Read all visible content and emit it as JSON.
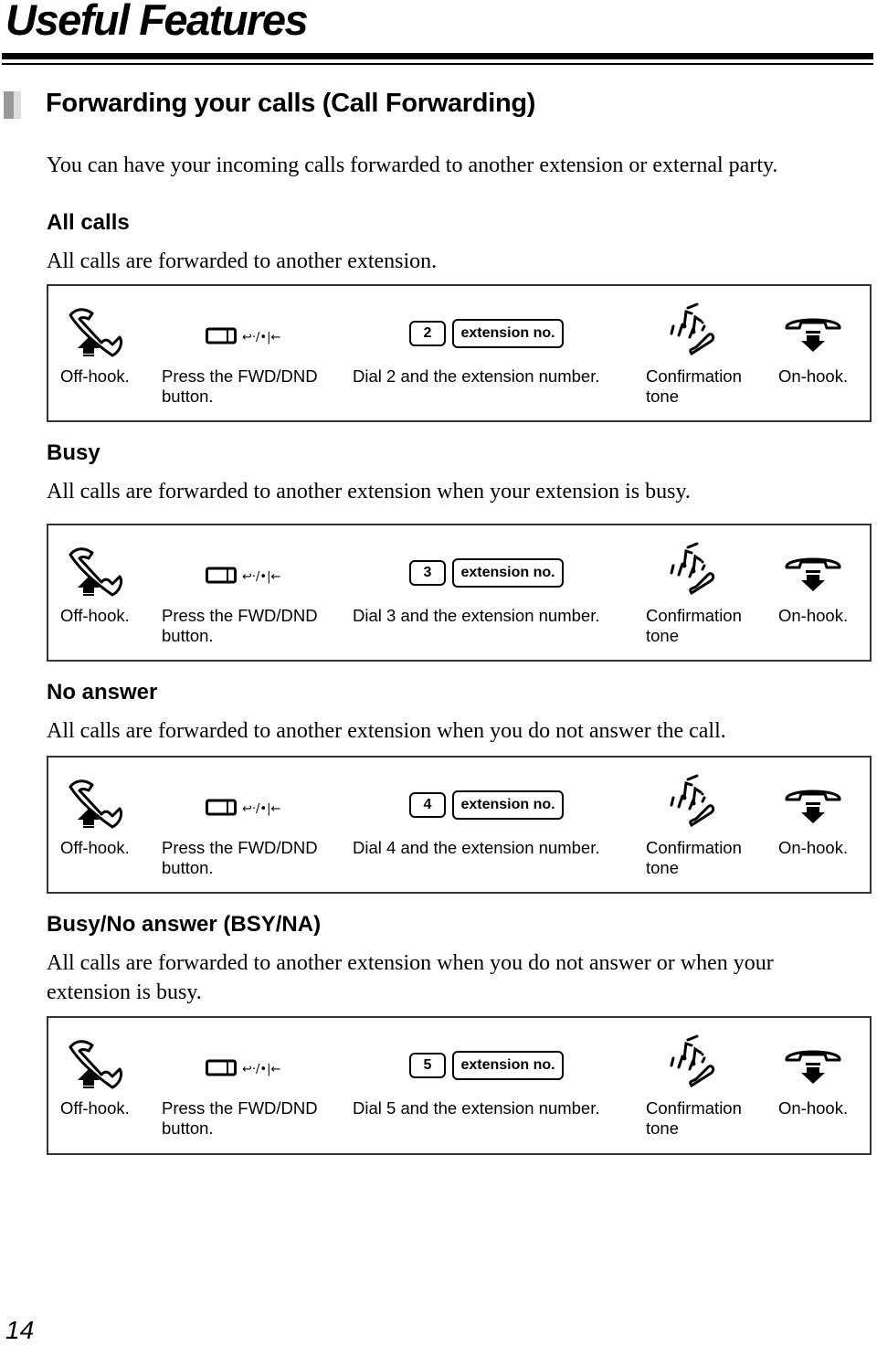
{
  "page": {
    "title": "Useful Features",
    "page_number": "14"
  },
  "section": {
    "title": "Forwarding your calls (Call Forwarding)",
    "intro": "You can have your incoming calls forwarded to another extension or external party."
  },
  "procedures": [
    {
      "heading": "All calls",
      "description": "All calls are forwarded to another extension.",
      "steps": {
        "off_hook": "Off-hook.",
        "press_fwd": "Press the FWD/DND button.",
        "dial_key": "2",
        "ext_key": "extension no.",
        "dial_text": "Dial 2 and the extension number.",
        "confirm": "Confirmation tone",
        "on_hook": "On-hook."
      }
    },
    {
      "heading": "Busy",
      "description": "All calls are forwarded to another extension when your extension is busy.",
      "steps": {
        "off_hook": "Off-hook.",
        "press_fwd": "Press the FWD/DND button.",
        "dial_key": "3",
        "ext_key": "extension no.",
        "dial_text": "Dial 3 and the extension number.",
        "confirm": "Confirmation tone",
        "on_hook": "On-hook."
      }
    },
    {
      "heading": "No answer",
      "description": "All calls are forwarded to another extension when you do not answer the call.",
      "steps": {
        "off_hook": "Off-hook.",
        "press_fwd": "Press the FWD/DND button.",
        "dial_key": "4",
        "ext_key": "extension no.",
        "dial_text": "Dial 4 and the extension number.",
        "confirm": "Confirmation tone",
        "on_hook": "On-hook."
      }
    },
    {
      "heading": "Busy/No answer (BSY/NA)",
      "description": "All calls are forwarded to another extension when you do not answer or when your extension is busy.",
      "steps": {
        "off_hook": "Off-hook.",
        "press_fwd": "Press the FWD/DND button.",
        "dial_key": "5",
        "ext_key": "extension no.",
        "dial_text": "Dial 5 and the extension number.",
        "confirm": "Confirmation tone",
        "on_hook": "On-hook."
      }
    }
  ],
  "icons": {
    "off_hook": "handset-lift-icon",
    "fwd_button": "fwd-dnd-button-icon",
    "confirm": "confirmation-tone-icon",
    "on_hook": "handset-down-icon"
  }
}
